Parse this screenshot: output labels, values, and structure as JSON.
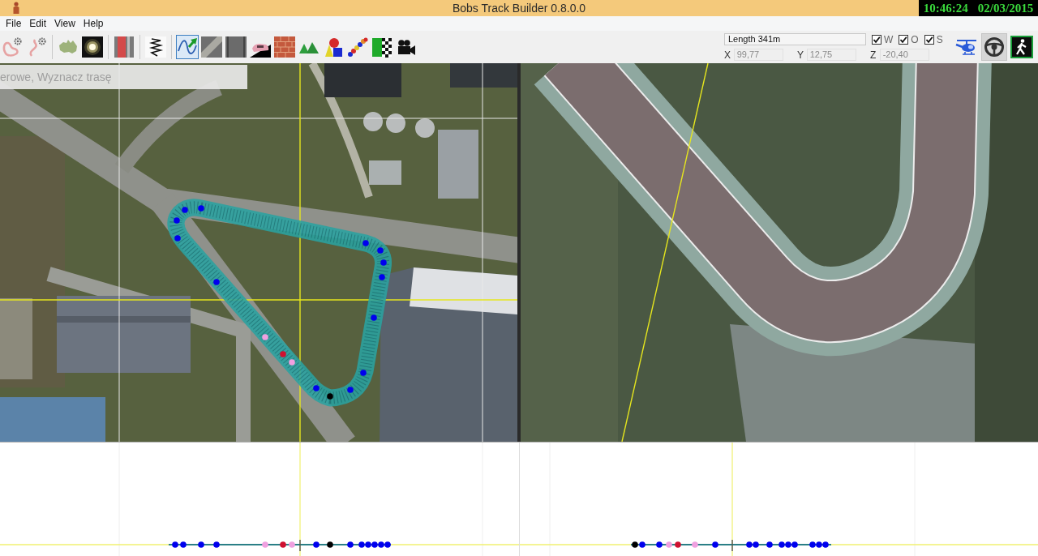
{
  "window": {
    "title": "Bobs Track Builder 0.8.0.0"
  },
  "clock": {
    "time": "10:46:24",
    "date": "02/03/2015"
  },
  "menu": [
    {
      "label": "File"
    },
    {
      "label": "Edit"
    },
    {
      "label": "View"
    },
    {
      "label": "Help"
    }
  ],
  "toolbar": {
    "groups": [
      {
        "tools": [
          {
            "selected": false
          },
          {
            "selected": false
          }
        ]
      },
      {
        "tools": [
          {
            "selected": false
          },
          {
            "selected": false
          }
        ]
      },
      {
        "tools": [
          {
            "selected": false
          }
        ]
      },
      {
        "tools": [
          {
            "selected": false
          }
        ]
      },
      {
        "tools": [
          {
            "selected": true
          },
          {
            "selected": false
          },
          {
            "selected": false
          },
          {
            "selected": false
          },
          {
            "selected": false
          },
          {
            "selected": false
          },
          {
            "selected": false
          },
          {
            "selected": false
          },
          {
            "selected": false
          },
          {
            "selected": false
          }
        ]
      }
    ],
    "length": {
      "value": "Length 341m"
    },
    "layers": [
      {
        "label": "W",
        "checked": true
      },
      {
        "label": "O",
        "checked": true
      },
      {
        "label": "S",
        "checked": true
      }
    ],
    "coordinates": [
      {
        "label": "X",
        "value": "99,77",
        "disabled": true
      },
      {
        "label": "Y",
        "value": "12,75",
        "disabled": true
      },
      {
        "label": "Z",
        "value": "-20,40",
        "disabled": true
      }
    ],
    "view_modes": [
      {
        "selected": false
      },
      {
        "selected": true
      },
      {
        "selected": false
      }
    ]
  },
  "plan_view": {
    "hint": "erowe, Wyznacz trasę",
    "points": [
      {
        "color": "#0000ee"
      },
      {
        "color": "#0000ee"
      },
      {
        "color": "#0000ee"
      },
      {
        "color": "#0000ee"
      },
      {
        "color": "#0000ee"
      },
      {
        "color": "#f0a0e0"
      },
      {
        "color": "#d01030"
      },
      {
        "color": "#f0a0e0"
      },
      {
        "color": "#0000ee"
      },
      {
        "color": "#000000"
      },
      {
        "color": "#0000ee"
      },
      {
        "color": "#0000ee"
      },
      {
        "color": "#0000ee"
      },
      {
        "color": "#0000ee"
      },
      {
        "color": "#0000ee"
      },
      {
        "color": "#0000ee"
      },
      {
        "color": "#0000ee"
      }
    ]
  },
  "profiles": [
    {
      "points": [
        {
          "color": "#0000ee"
        },
        {
          "color": "#0000ee"
        },
        {
          "color": "#0000ee"
        },
        {
          "color": "#0000ee"
        },
        {
          "color": "#f0a0e0"
        },
        {
          "color": "#d01030"
        },
        {
          "color": "#f0a0e0"
        },
        {
          "color": "#0000ee"
        },
        {
          "color": "#000000"
        },
        {
          "color": "#0000ee"
        },
        {
          "color": "#0000ee"
        },
        {
          "color": "#0000ee"
        },
        {
          "color": "#0000ee"
        },
        {
          "color": "#0000ee"
        },
        {
          "color": "#0000ee"
        }
      ]
    },
    {
      "points": [
        {
          "color": "#000000"
        },
        {
          "color": "#0000ee"
        },
        {
          "color": "#0000ee"
        },
        {
          "color": "#f0a0e0"
        },
        {
          "color": "#d01030"
        },
        {
          "color": "#f0a0e0"
        },
        {
          "color": "#0000ee"
        },
        {
          "color": "#0000ee"
        },
        {
          "color": "#0000ee"
        },
        {
          "color": "#0000ee"
        },
        {
          "color": "#0000ee"
        },
        {
          "color": "#0000ee"
        },
        {
          "color": "#0000ee"
        },
        {
          "color": "#0000ee"
        },
        {
          "color": "#0000ee"
        },
        {
          "color": "#0000ee"
        }
      ]
    }
  ]
}
